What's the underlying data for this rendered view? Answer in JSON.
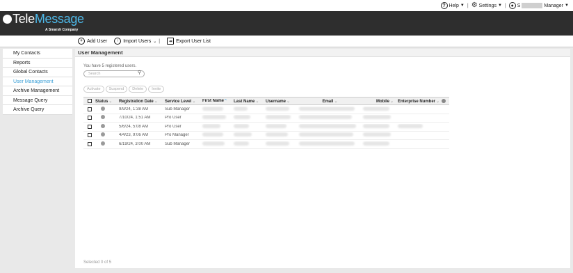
{
  "topbar": {
    "help_label": "Help",
    "settings_label": "Settings",
    "user_initial": "S",
    "role_label": "Manager"
  },
  "brand": {
    "name_part1": "Tele",
    "name_part2": "Message",
    "tagline": "A Smarsh Company"
  },
  "toolbar": {
    "add_user": "Add User",
    "import_users": "Import Users",
    "export_list": "Export User List"
  },
  "sidebar": {
    "items": [
      {
        "label": "My Contacts",
        "active": false
      },
      {
        "label": "Reports",
        "active": false
      },
      {
        "label": "Global Contacts",
        "active": false
      },
      {
        "label": "User Management",
        "active": true
      },
      {
        "label": "Archive Management",
        "active": false
      },
      {
        "label": "Message Query",
        "active": false
      },
      {
        "label": "Archive Query",
        "active": false
      }
    ]
  },
  "main": {
    "title": "User Management",
    "count_text": "You have 5 registered users.",
    "search_placeholder": "Search",
    "actions": [
      "Activate",
      "Suspend",
      "Delete",
      "Invite"
    ],
    "columns": [
      "Status",
      "Registration Date",
      "Service Level",
      "First Name",
      "Last Name",
      "Username",
      "Email",
      "Mobile",
      "Enterprise Number"
    ],
    "rows": [
      {
        "date": "9/9/24, 1:38 AM",
        "level": "Sub Manager"
      },
      {
        "date": "7/10/24, 1:51 AM",
        "level": "Pro User"
      },
      {
        "date": "5/6/24, 5:08 AM",
        "level": "Pro User"
      },
      {
        "date": "4/4/23, 9:06 AM",
        "level": "Pro Manager"
      },
      {
        "date": "6/19/24, 3:00 AM",
        "level": "Sub Manager"
      }
    ],
    "footer": "Selected 0 of 5"
  },
  "colors": {
    "header_bg": "#2e2e2e",
    "accent": "#3b9fd6"
  }
}
